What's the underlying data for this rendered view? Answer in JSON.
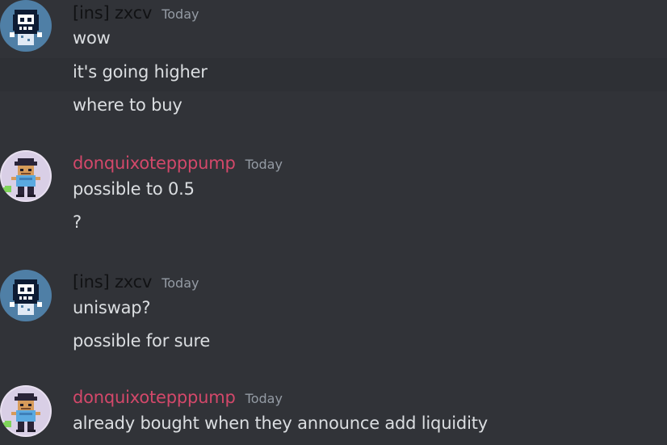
{
  "messages": [
    {
      "author": "[ins] zxcv",
      "timestamp": "Today",
      "avatar": "pixel-skull-avatar-icon",
      "author_color": "#111214",
      "lines": [
        "wow",
        "it's going higher",
        "where to buy"
      ]
    },
    {
      "author": "donquixotepppump",
      "timestamp": "Today",
      "avatar": "pixel-character-avatar-icon",
      "author_color": "#d3486a",
      "lines": [
        "possible to 0.5",
        "?"
      ]
    },
    {
      "author": "[ins] zxcv",
      "timestamp": "Today",
      "avatar": "pixel-skull-avatar-icon",
      "author_color": "#111214",
      "lines": [
        "uniswap?",
        "possible for sure"
      ]
    },
    {
      "author": "donquixotepppump",
      "timestamp": "Today",
      "avatar": "pixel-character-avatar-icon",
      "author_color": "#d3486a",
      "lines": [
        "already bought when they announce add liquidity"
      ]
    }
  ],
  "colors": {
    "background": "#313338",
    "hover_row": "#2e3035",
    "message_text": "#dbdee1",
    "timestamp": "#949ba4"
  }
}
